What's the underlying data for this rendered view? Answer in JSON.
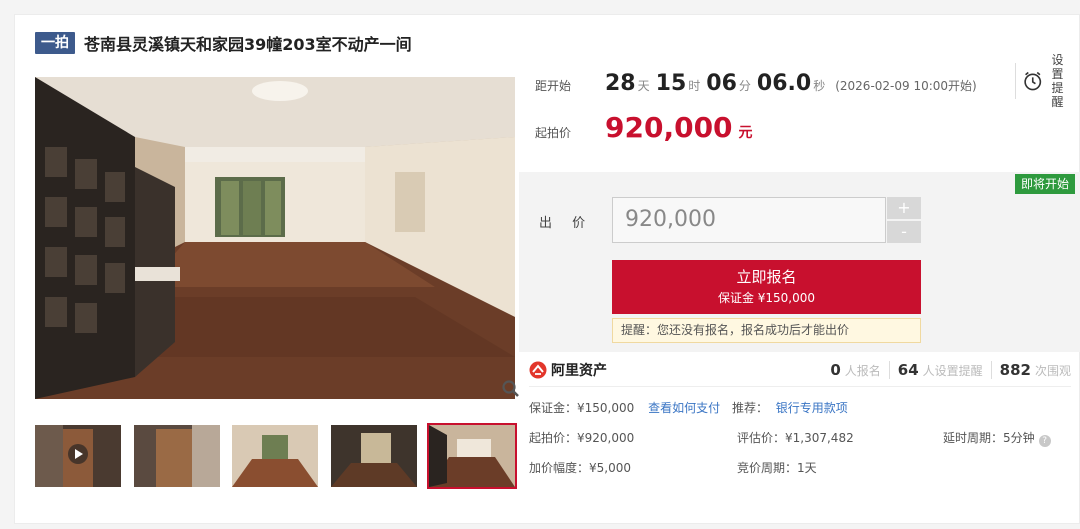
{
  "header": {
    "badge": "一拍",
    "title": "苍南县灵溪镇天和家园39幢203室不动产一间"
  },
  "countdown": {
    "label": "距开始",
    "days": "28",
    "days_unit": "天",
    "hours": "15",
    "hours_unit": "时",
    "minutes": "06",
    "minutes_unit": "分",
    "seconds": "06.0",
    "seconds_unit": "秒",
    "start_time": "(2026-02-09 10:00开始)"
  },
  "reminder": {
    "line1": "设置",
    "line2": "提醒",
    "icon": "alarm-clock-icon"
  },
  "start_price": {
    "label": "起拍价",
    "value": "920,000",
    "unit": "元"
  },
  "bid": {
    "soon_badge": "即将开始",
    "label": "出 价",
    "value": "920,000",
    "plus": "+",
    "minus": "-",
    "signup_main": "立即报名",
    "signup_sub": "保证金 ¥150,000",
    "tip": "提醒：您还没有报名，报名成功后才能出价"
  },
  "stats": {
    "brand": "阿里资产",
    "signups_num": "0",
    "signups_label": "人报名",
    "reminders_num": "64",
    "reminders_label": "人设置提醒",
    "views_num": "882",
    "views_label": "次围观"
  },
  "details": {
    "deposit": "保证金：¥150,000",
    "how_to_pay": "查看如何支付",
    "recommend": "推荐：",
    "bank_link": "银行专用款项",
    "start_price": "起拍价：¥920,000",
    "appraisal": "评估价：¥1,307,482",
    "delay": "延时周期：5分钟",
    "increment": "加价幅度：¥5,000",
    "cycle": "竞价周期：1天"
  },
  "colors": {
    "brand_red": "#c8102e",
    "badge_blue": "#3d5a8c",
    "soon_green": "#2e9a3e",
    "link_blue": "#3a75c4"
  }
}
